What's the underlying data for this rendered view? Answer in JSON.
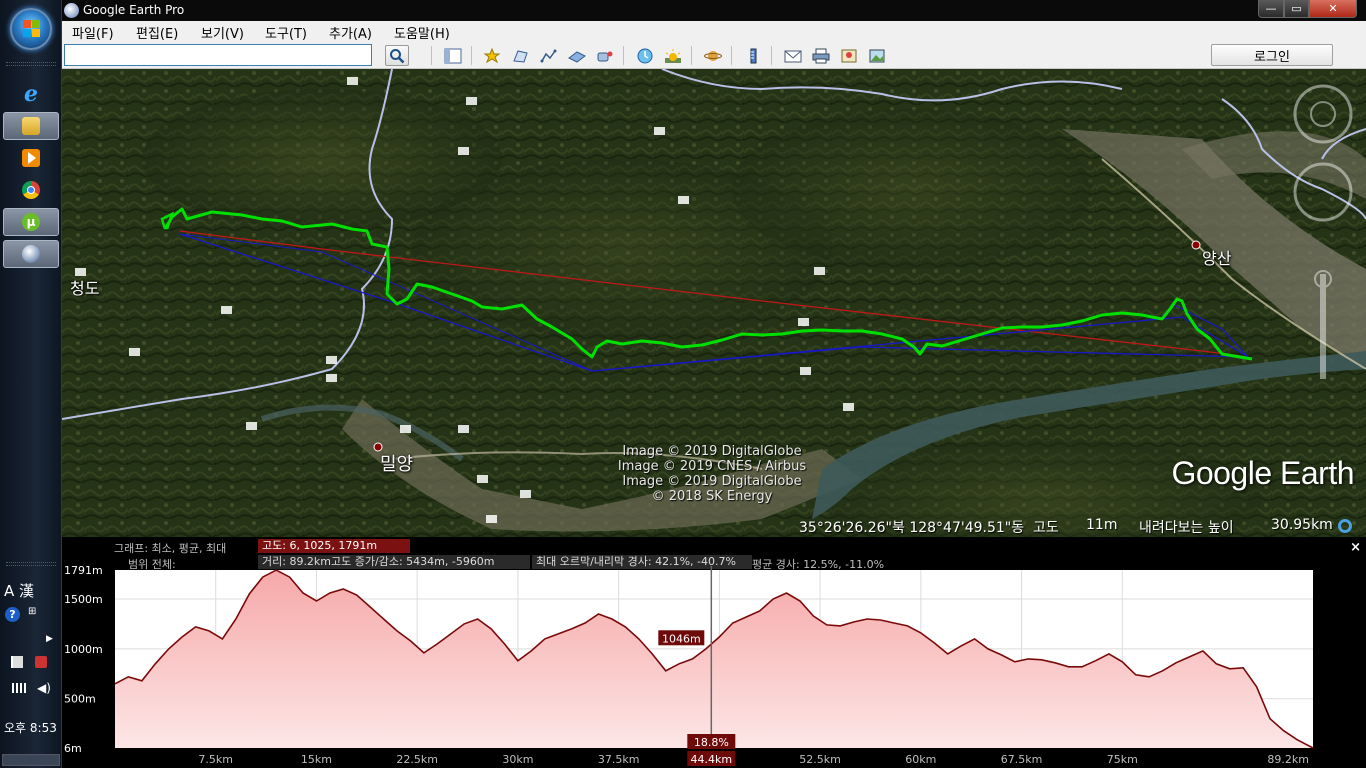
{
  "window": {
    "title": "Google Earth Pro",
    "min": "—",
    "max": "▭",
    "close": "✕"
  },
  "menu": [
    "파일(F)",
    "편집(E)",
    "보기(V)",
    "도구(T)",
    "추가(A)",
    "도움말(H)"
  ],
  "search": {
    "value": ""
  },
  "toolbar": {
    "login": "로그인",
    "icons": [
      "search-icon",
      "sidebar-icon",
      "placemark-icon",
      "polygon-icon",
      "path-icon",
      "overlay-icon",
      "tour-icon",
      "history-icon",
      "sun-icon",
      "planets-icon",
      "ruler-icon",
      "email-icon",
      "print-icon",
      "view-in-maps-icon",
      "save-image-icon"
    ]
  },
  "taskbar": {
    "time": "오후 8:53",
    "ime": "A 漢",
    "apps": [
      "ie-icon",
      "explorer-icon",
      "media-player-icon",
      "chrome-icon",
      "utorrent-icon",
      "google-earth-icon"
    ]
  },
  "map": {
    "labels": [
      {
        "id": "cheongdo",
        "text": "청도"
      },
      {
        "id": "yangsan",
        "text": "양산"
      },
      {
        "id": "miryang",
        "text": "밀양"
      }
    ],
    "copyright": [
      "Image © 2019 DigitalGlobe",
      "Image © 2019 CNES / Airbus",
      "Image © 2019 DigitalGlobe",
      "© 2018 SK Energy"
    ],
    "logo": "Google Earth",
    "status": {
      "coords": "35°26'26.26\"북  128°47'49.51\"동",
      "alt_label": "고도",
      "alt_value": "11m",
      "eye_label": "내려다보는 높이",
      "eye_value": "30.95km"
    }
  },
  "profile": {
    "graph_label": "그래프: 최소, 평균, 최대",
    "graph_value": "고도: 6, 1025, 1791m",
    "range_label": "범위 전체:",
    "range_value": "거리: 89.2km고도 증가/감소: 5434m, -5960m",
    "range_value_2": "최대 오르막/내리막 경사: 42.1%, -40.7%",
    "range_value_3": "평균 경사: 12.5%, -11.0%",
    "close": "×",
    "cursor_altitude": "1046m",
    "cursor_slope": "18.8%",
    "cursor_distance": "44.4km",
    "top_left_label": "1791m",
    "y_ticks": [
      "1500m",
      "1000m",
      "500m",
      "6m"
    ],
    "x_ticks": [
      "7.5km",
      "15km",
      "22.5km",
      "30km",
      "37.5km",
      "44.4km",
      "52.5km",
      "60km",
      "67.5km",
      "75km",
      "89.2km"
    ]
  },
  "chart_data": {
    "type": "area",
    "title": "",
    "xlabel": "",
    "ylabel": "",
    "xlim": [
      0,
      89.2
    ],
    "ylim": [
      6,
      1791
    ],
    "x_ticks": [
      7.5,
      15,
      22.5,
      30,
      37.5,
      45,
      52.5,
      60,
      67.5,
      75
    ],
    "y_ticks": [
      500,
      1000,
      1500
    ],
    "cursor": {
      "x": 44.4,
      "y": 1046,
      "slope_percent": 18.8
    },
    "series": [
      {
        "x": [
          0,
          1,
          2,
          3,
          4,
          5,
          6,
          7,
          8,
          9,
          10,
          11,
          12,
          13,
          14,
          15,
          16,
          17,
          18,
          19,
          20,
          21,
          22,
          23,
          24,
          25,
          26,
          27,
          28,
          29,
          30,
          31,
          32,
          33,
          34,
          35,
          36,
          37,
          38,
          39,
          40,
          41,
          42,
          43,
          44,
          45,
          46,
          47,
          48,
          49,
          50,
          51,
          52,
          53,
          54,
          55,
          56,
          57,
          58,
          59,
          60,
          61,
          62,
          63,
          64,
          65,
          66,
          67,
          68,
          69,
          70,
          71,
          72,
          73,
          74,
          75,
          76,
          77,
          78,
          79,
          80,
          81,
          82,
          83,
          84,
          85,
          86,
          87,
          88,
          89.2
        ],
        "y": [
          650,
          720,
          680,
          850,
          1000,
          1120,
          1220,
          1180,
          1100,
          1300,
          1550,
          1720,
          1790,
          1720,
          1560,
          1480,
          1560,
          1600,
          1540,
          1420,
          1300,
          1180,
          1080,
          960,
          1050,
          1150,
          1250,
          1300,
          1200,
          1050,
          880,
          980,
          1100,
          1150,
          1200,
          1260,
          1350,
          1300,
          1220,
          1100,
          950,
          780,
          850,
          900,
          1000,
          1120,
          1260,
          1320,
          1380,
          1500,
          1560,
          1480,
          1330,
          1240,
          1230,
          1270,
          1300,
          1290,
          1260,
          1230,
          1160,
          1060,
          950,
          1030,
          1100,
          1000,
          940,
          870,
          900,
          890,
          860,
          820,
          820,
          880,
          950,
          870,
          740,
          720,
          780,
          860,
          920,
          980,
          850,
          800,
          810,
          620,
          300,
          180,
          90,
          6
        ]
      }
    ]
  }
}
